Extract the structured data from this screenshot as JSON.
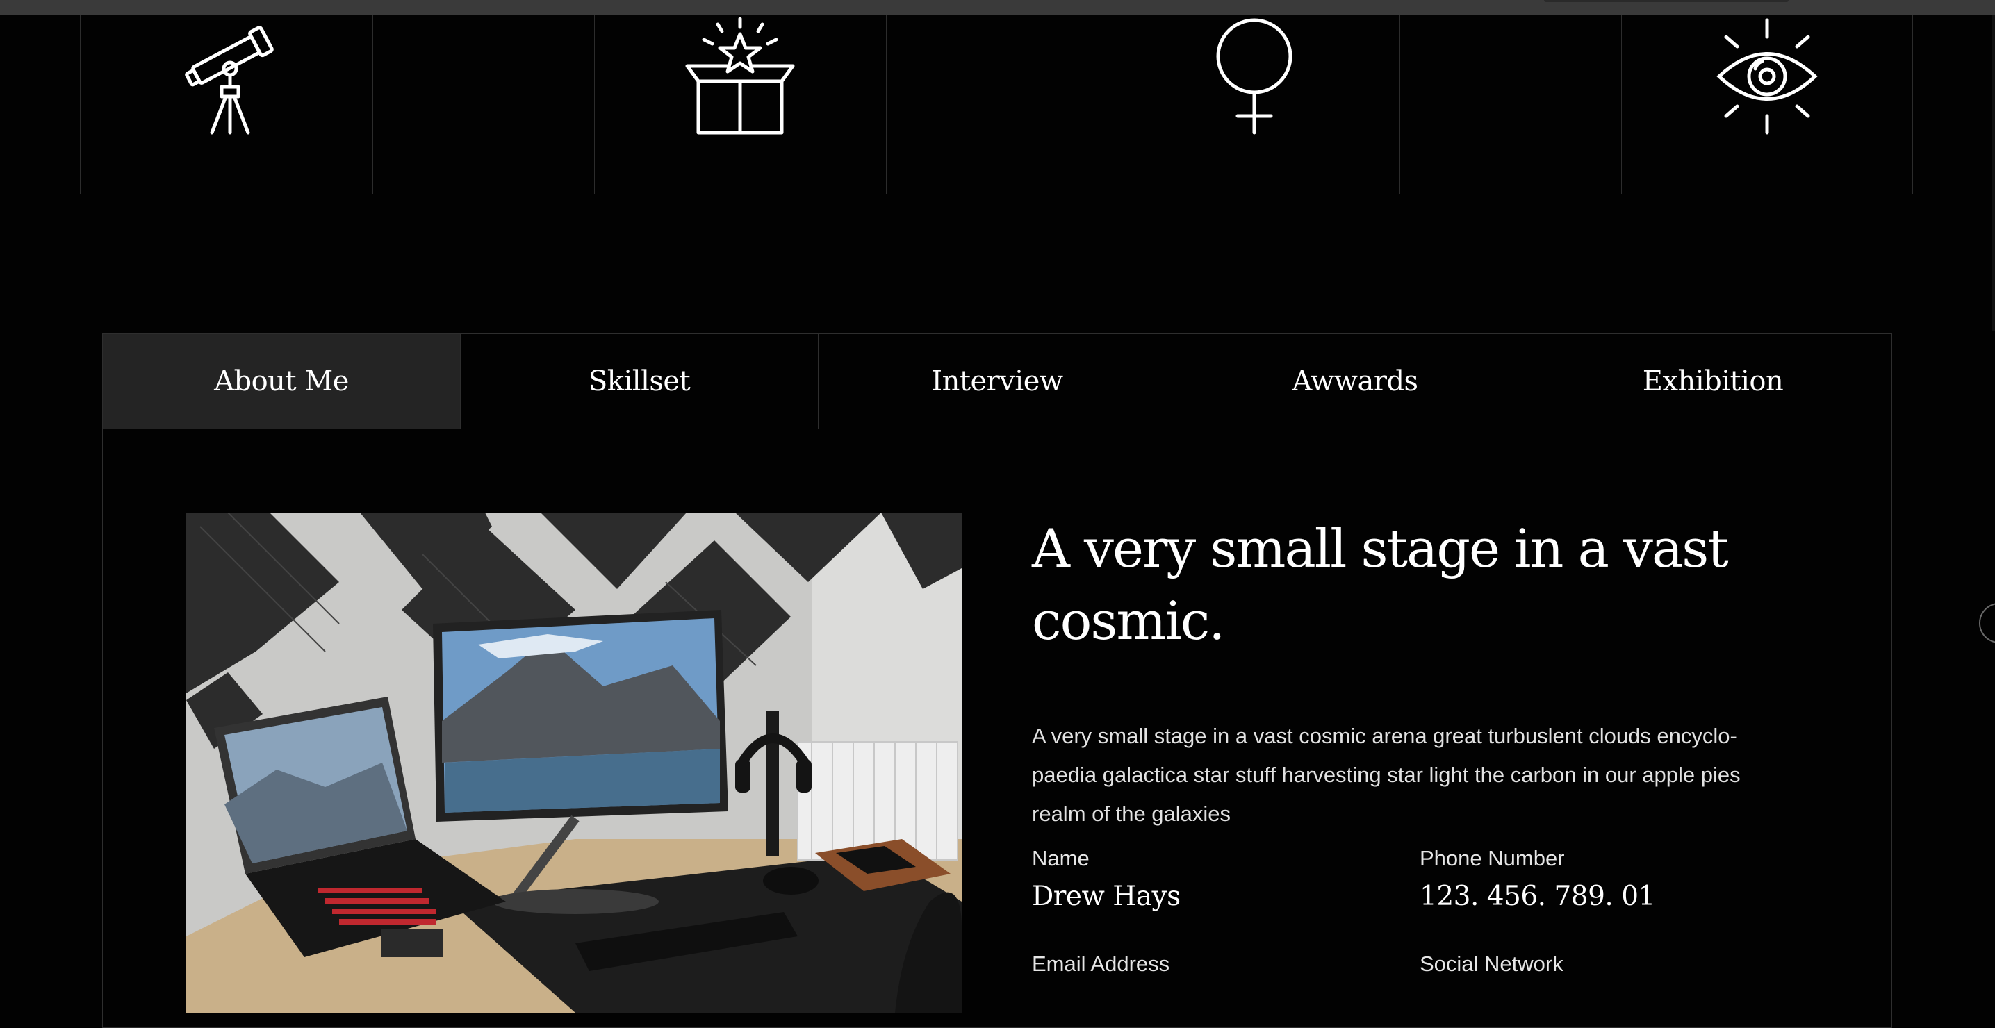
{
  "icons": [
    "telescope-icon",
    "gift-box-star-icon",
    "venus-symbol-icon",
    "eye-icon"
  ],
  "tabs": [
    {
      "label": "About Me",
      "active": true
    },
    {
      "label": "Skillset",
      "active": false
    },
    {
      "label": "Interview",
      "active": false
    },
    {
      "label": "Awwards",
      "active": false
    },
    {
      "label": "Exhibition",
      "active": false
    }
  ],
  "about": {
    "headline": "A very small stage in a vast cosmic.",
    "description": "A very small stage in a vast cosmic arena great turbuslent clouds encyclo- paedia galactica star stuff harvesting star light the carbon in our apple pies realm of the galaxies",
    "name_label": "Name",
    "name_value": "Drew Hays",
    "phone_label": "Phone Number",
    "phone_value": "123. 456. 789. 01",
    "email_label": "Email Address",
    "social_label": "Social Network"
  },
  "colors": {
    "background": "#020202",
    "active_tab": "#242424",
    "divider": "#2e2e2e"
  }
}
